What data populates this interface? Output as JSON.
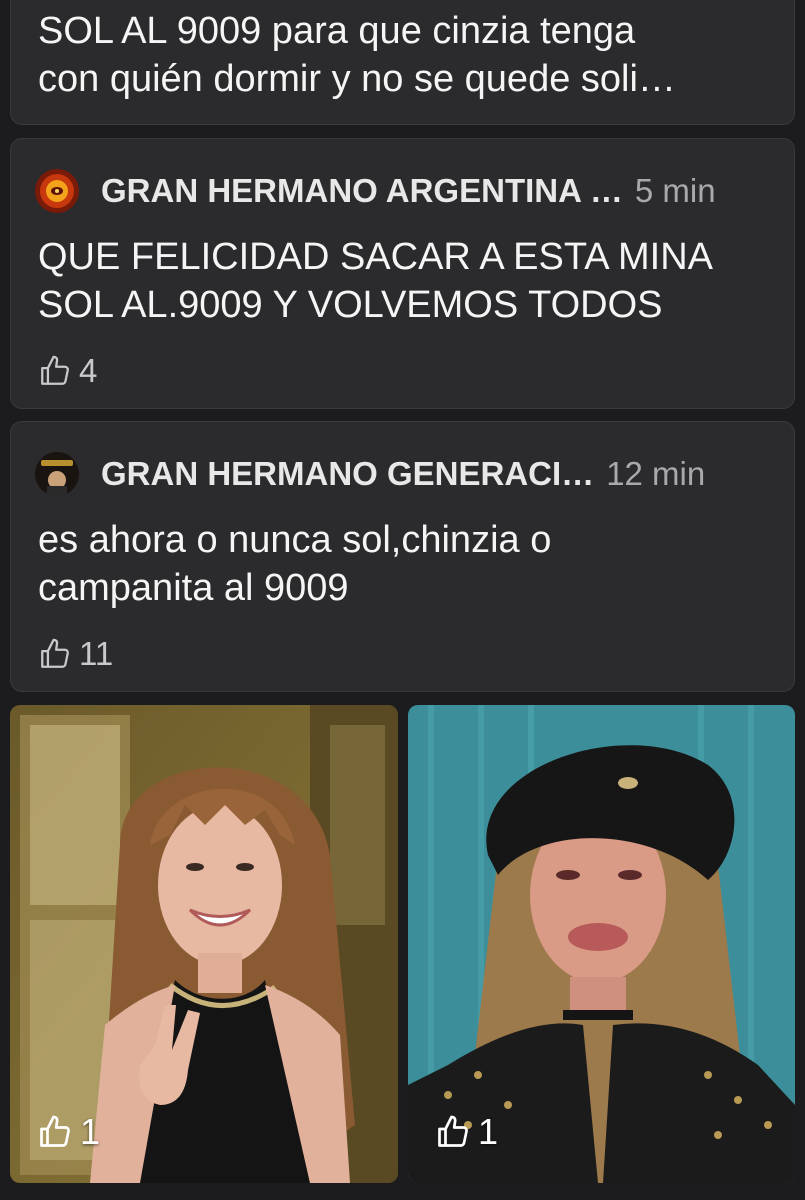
{
  "feed": {
    "first_card": {
      "text": "SOL AL 9009 para que cinzia tenga\ncon quién dormir y no se quede soli…"
    },
    "comments": [
      {
        "author": "GRAN HERMANO ARGENTINA …",
        "time": "5 min",
        "text": "QUE FELICIDAD SACAR A ESTA MINA\nSOL AL.9009 Y VOLVEMOS TODOS",
        "likes": "4"
      },
      {
        "author": "GRAN HERMANO GENERACI…",
        "time": "12 min",
        "text": "es ahora o nunca sol,chinzia o\ncampanita al 9009",
        "likes": "11"
      }
    ],
    "photos": [
      {
        "likes": "1"
      },
      {
        "likes": "1"
      }
    ]
  },
  "colors": {
    "background": "#1c1c1e",
    "card": "#2b2b2d",
    "text": "#f5f5f5",
    "muted": "#a9a9ad"
  }
}
